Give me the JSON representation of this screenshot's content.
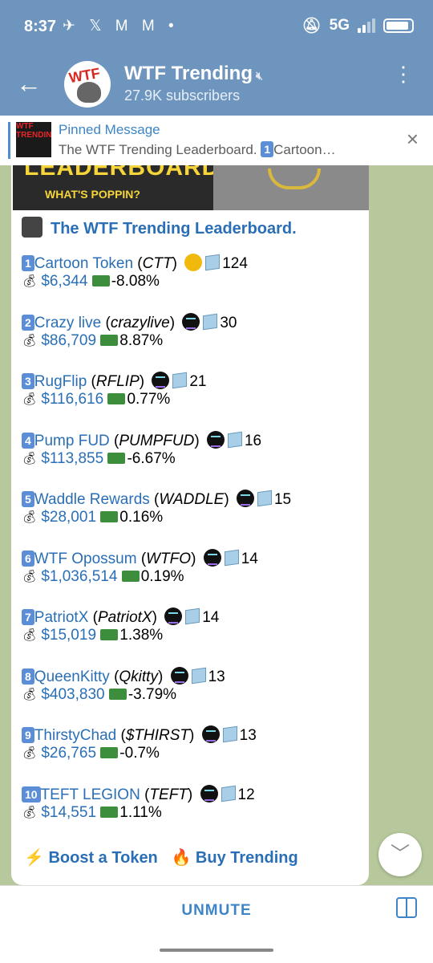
{
  "status_bar": {
    "time": "8:37",
    "network": "5G",
    "battery_pct": 90,
    "notif_icons": "✈ 𝕏 M M •"
  },
  "header": {
    "back": "←",
    "title": "WTF Trending",
    "subtitle": "27.9K subscribers",
    "menu": "⋮",
    "avatar_text": "WTF"
  },
  "pinned": {
    "title": "Pinned Message",
    "text": "The WTF Trending Leaderboard.",
    "badge": "1",
    "text_tail": "Cartoon…",
    "close": "×",
    "thumb_text": "WTF TRENDING"
  },
  "banner": {
    "big": "LEADERBOARD",
    "tagline": "WHAT'S POPPIN?"
  },
  "message": {
    "heading": "The WTF Trending Leaderboard.",
    "entries": [
      {
        "rank": "1",
        "name": "Cartoon Token",
        "ticker": "CTT",
        "chain": "bnb",
        "count": "124",
        "price": "$6,344",
        "change": "-8.08%"
      },
      {
        "rank": "2",
        "name": "Crazy live",
        "ticker": "crazylive",
        "chain": "sol",
        "count": "30",
        "price": "$86,709",
        "change": "8.87%"
      },
      {
        "rank": "3",
        "name": "RugFlip",
        "ticker": "RFLIP",
        "chain": "sol",
        "count": "21",
        "price": "$116,616",
        "change": "0.77%"
      },
      {
        "rank": "4",
        "name": "Pump FUD",
        "ticker": "PUMPFUD",
        "chain": "sol",
        "count": "16",
        "price": "$113,855",
        "change": "-6.67%"
      },
      {
        "rank": "5",
        "name": "Waddle Rewards",
        "ticker": "WADDLE",
        "chain": "sol",
        "count": "15",
        "price": "$28,001",
        "change": "0.16%"
      },
      {
        "rank": "6",
        "name": "WTF Opossum ",
        "ticker": "WTFO",
        "chain": "sol",
        "count": "14",
        "price": "$1,036,514",
        "change": "0.19%"
      },
      {
        "rank": "7",
        "name": "PatriotX",
        "ticker": "PatriotX",
        "chain": "sol",
        "count": "14",
        "price": "$15,019",
        "change": "1.38%"
      },
      {
        "rank": "8",
        "name": "QueenKitty",
        "ticker": "Qkitty",
        "chain": "sol",
        "count": "13",
        "price": "$403,830",
        "change": "-3.79%"
      },
      {
        "rank": "9",
        "name": "ThirstyChad",
        "ticker": "$THIRST",
        "chain": "sol",
        "count": "13",
        "price": "$26,765",
        "change": "-0.7%"
      },
      {
        "rank": "10",
        "name": "TEFT LEGION",
        "ticker": "TEFT",
        "chain": "sol",
        "count": "12",
        "price": "$14,551",
        "change": "1.11%"
      }
    ],
    "links": {
      "boost": "Boost a Token",
      "boost_icon": "⚡",
      "buy": "Buy Trending",
      "buy_icon": "🔥"
    }
  },
  "bottom": {
    "unmute": "UNMUTE"
  },
  "colors": {
    "header_bg": "#6e95bd",
    "link": "#2a6fb6",
    "accent": "#3d85c6",
    "chat_bg": "#b7c99c"
  }
}
